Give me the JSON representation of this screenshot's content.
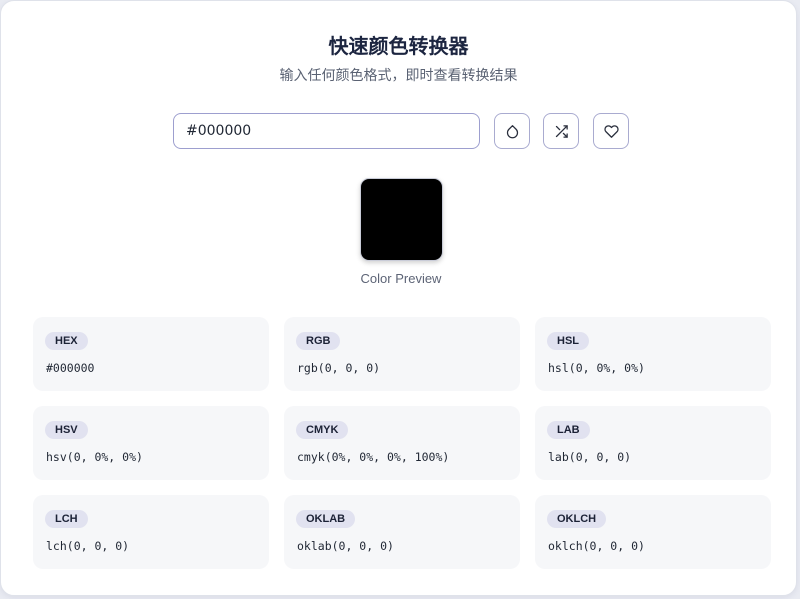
{
  "header": {
    "title": "快速颜色转换器",
    "subtitle": "输入任何颜色格式，即时查看转换结果"
  },
  "input": {
    "value": "#000000",
    "placeholder": ""
  },
  "toolbar": {
    "buttons": [
      {
        "icon": "droplet-icon"
      },
      {
        "icon": "shuffle-icon"
      },
      {
        "icon": "heart-icon"
      }
    ]
  },
  "preview": {
    "color": "#000000",
    "label": "Color Preview"
  },
  "formats": [
    {
      "label": "HEX",
      "value": "#000000"
    },
    {
      "label": "RGB",
      "value": "rgb(0, 0, 0)"
    },
    {
      "label": "HSL",
      "value": "hsl(0, 0%, 0%)"
    },
    {
      "label": "HSV",
      "value": "hsv(0, 0%, 0%)"
    },
    {
      "label": "CMYK",
      "value": "cmyk(0%, 0%, 0%, 100%)"
    },
    {
      "label": "LAB",
      "value": "lab(0, 0, 0)"
    },
    {
      "label": "LCH",
      "value": "lch(0, 0, 0)"
    },
    {
      "label": "OKLAB",
      "value": "oklab(0, 0, 0)"
    },
    {
      "label": "OKLCH",
      "value": "oklch(0, 0, 0)"
    }
  ]
}
